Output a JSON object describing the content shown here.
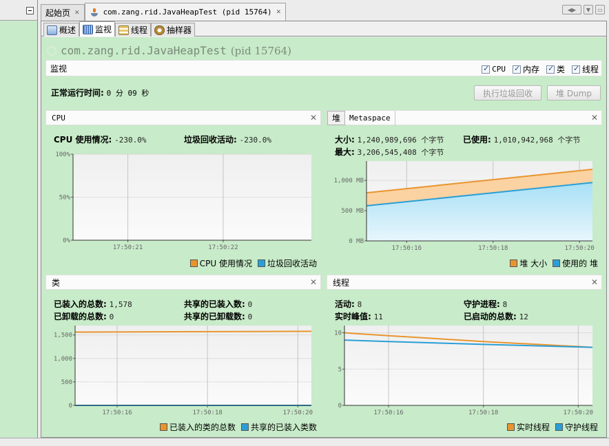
{
  "editor_tabs": [
    {
      "label": "起始页",
      "active": false
    },
    {
      "label": "com.zang.rid.JavaHeapTest (pid 15764)",
      "active": true
    }
  ],
  "sub_tabs": [
    {
      "label": "概述",
      "icon": "overview-icon"
    },
    {
      "label": "监视",
      "icon": "monitor-icon",
      "active": true
    },
    {
      "label": "线程",
      "icon": "threads-icon"
    },
    {
      "label": "抽样器",
      "icon": "sampler-icon"
    }
  ],
  "app": {
    "title": "com.zang.rid.JavaHeapTest",
    "pid": "(pid 15764)"
  },
  "section": {
    "label": "监视",
    "checkboxes": [
      {
        "label": "CPU",
        "checked": true
      },
      {
        "label": "内存",
        "checked": true
      },
      {
        "label": "类",
        "checked": true
      },
      {
        "label": "线程",
        "checked": true
      }
    ]
  },
  "uptime": {
    "label": "正常运行时间:",
    "value": "0 分 09 秒"
  },
  "actions": {
    "gc": "执行垃圾回收",
    "heap_dump": "堆 Dump"
  },
  "panels": {
    "cpu": {
      "title": "CPU",
      "stats": [
        {
          "label": "CPU 使用情况:",
          "value": "-230.0%"
        },
        {
          "label": "垃圾回收活动:",
          "value": "-230.0%"
        }
      ]
    },
    "memory": {
      "tabs": [
        "堆",
        "Metaspace"
      ],
      "stats": [
        {
          "label": "大小:",
          "value": "1,240,989,696 个字节"
        },
        {
          "label": "已使用:",
          "value": "1,010,942,968 个字节"
        },
        {
          "label": "最大:",
          "value": "3,206,545,408 个字节"
        }
      ]
    },
    "classes": {
      "title": "类",
      "stats": [
        {
          "label": "已装入的总数:",
          "value": "1,578"
        },
        {
          "label": "共享的已装入数:",
          "value": "0"
        },
        {
          "label": "已卸载的总数:",
          "value": "0"
        },
        {
          "label": "共享的已卸载数:",
          "value": "0"
        }
      ]
    },
    "threads": {
      "title": "线程",
      "stats": [
        {
          "label": "活动:",
          "value": "8"
        },
        {
          "label": "守护进程:",
          "value": "8"
        },
        {
          "label": "实时峰值:",
          "value": "11"
        },
        {
          "label": "已启动的总数:",
          "value": "12"
        }
      ]
    }
  },
  "colors": {
    "background": "#c8ebc9",
    "orange": "#e8952e",
    "blue": "#2a9fd6",
    "orange_fill": "#fbd2a2",
    "blue_fill": "#b8e4f7"
  },
  "chart_data": [
    {
      "id": "cpu",
      "type": "line",
      "title": "CPU",
      "x": [
        "17:50:20.3",
        "17:50:22.8"
      ],
      "xticks": [
        "17:50:21",
        "17:50:22"
      ],
      "yticks": [
        "0%",
        "50%",
        "100%"
      ],
      "ylim": [
        0,
        100
      ],
      "series": [
        {
          "name": "CPU 使用情况",
          "values": []
        },
        {
          "name": "垃圾回收活动",
          "values": []
        }
      ],
      "grid": true,
      "legend": "bottom-right"
    },
    {
      "id": "heap",
      "type": "area",
      "title": "堆",
      "x": [
        15.07,
        20.3
      ],
      "xticks": [
        "17:50:16",
        "17:50:18",
        "17:50:20"
      ],
      "xtick_values": [
        16,
        18,
        20
      ],
      "yticks": [
        "0 MB",
        "500 MB",
        "1,000 MB"
      ],
      "ytick_values": [
        0,
        500,
        1000
      ],
      "ylim": [
        0,
        1320
      ],
      "series": [
        {
          "name": "堆 大小",
          "values": [
            [
              15.07,
              795
            ],
            [
              20.3,
              1183
            ]
          ]
        },
        {
          "name": "使用的 堆",
          "values": [
            [
              15.07,
              580
            ],
            [
              20.3,
              964
            ]
          ]
        }
      ],
      "grid": true,
      "legend": "bottom-right"
    },
    {
      "id": "classes",
      "type": "line",
      "title": "类",
      "x": [
        15.07,
        20.3
      ],
      "xticks": [
        "17:50:16",
        "17:50:18",
        "17:50:20"
      ],
      "xtick_values": [
        16,
        18,
        20
      ],
      "yticks": [
        "0",
        "500",
        "1,000",
        "1,500"
      ],
      "ytick_values": [
        0,
        500,
        1000,
        1500
      ],
      "ylim": [
        0,
        1700
      ],
      "series": [
        {
          "name": "已装入的类的总数",
          "values": [
            [
              15.07,
              1560
            ],
            [
              20.3,
              1578
            ]
          ]
        },
        {
          "name": "共享的已装入类数",
          "values": [
            [
              15.07,
              0
            ],
            [
              20.3,
              0
            ]
          ]
        }
      ],
      "grid": true,
      "legend": "bottom-right"
    },
    {
      "id": "threads",
      "type": "line",
      "title": "线程",
      "x": [
        15.07,
        20.3
      ],
      "xticks": [
        "17:50:16",
        "17:50:18",
        "17:50:20"
      ],
      "xtick_values": [
        16,
        18,
        20
      ],
      "yticks": [
        "0",
        "5",
        "10"
      ],
      "ytick_values": [
        0,
        5,
        10
      ],
      "ylim": [
        0,
        11
      ],
      "series": [
        {
          "name": "实时线程",
          "values": [
            [
              15.07,
              10
            ],
            [
              16,
              9.6
            ],
            [
              18,
              8.8
            ],
            [
              20.3,
              8
            ]
          ]
        },
        {
          "name": "守护线程",
          "values": [
            [
              15.07,
              9
            ],
            [
              16,
              8.8
            ],
            [
              18,
              8.4
            ],
            [
              20.3,
              8
            ]
          ]
        }
      ],
      "grid": true,
      "legend": "bottom-right"
    }
  ]
}
